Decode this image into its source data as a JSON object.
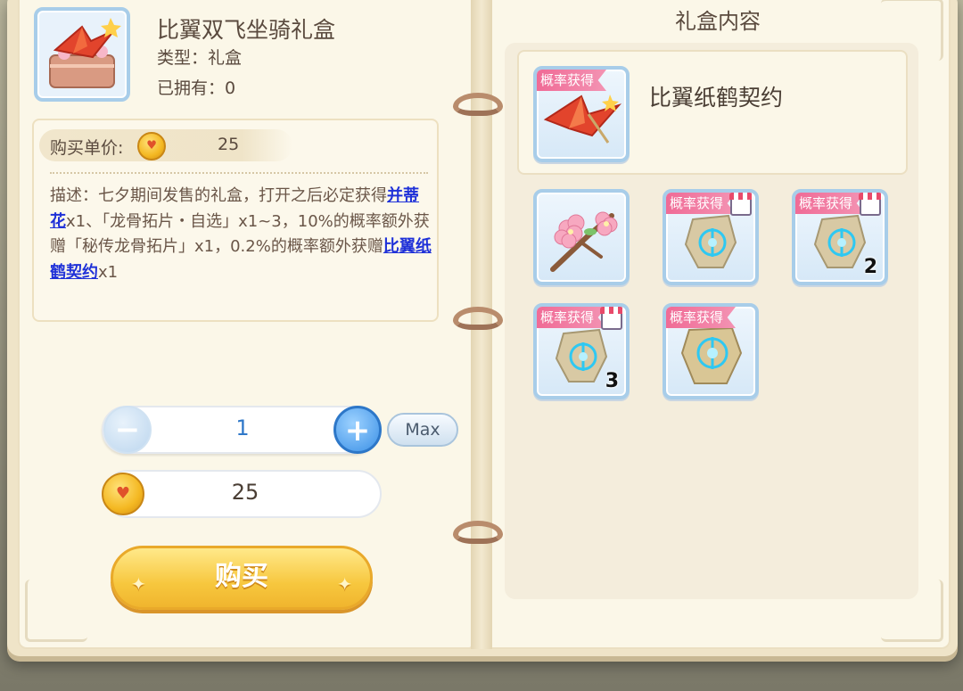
{
  "item": {
    "name": "比翼双飞坐骑礼盒",
    "type_label": "类型：礼盒",
    "owned_label": "已拥有：0",
    "icon": "gift-box-crane-icon"
  },
  "price": {
    "label": "购买单价:",
    "value": "25",
    "currency_icon": "gold-coin-icon"
  },
  "description": {
    "prefix": "描述：七夕期间发售的礼盒，打开之后必定获得",
    "link1": "并蒂花",
    "mid1": "x1、「龙骨拓片・自选」x1~3，10%的概率额外获赠「秘传龙骨拓片」x1，0.2%的概率额外获赠",
    "link2": "比翼纸鹤契约",
    "suffix": "x1"
  },
  "quantity": {
    "value": "1",
    "max_label": "Max"
  },
  "total": {
    "value": "25"
  },
  "buy_label": "购买",
  "contents": {
    "title": "礼盒内容",
    "featured": {
      "tag": "概率获得",
      "name": "比翼纸鹤契约",
      "icon": "paper-crane-icon"
    },
    "items": [
      {
        "name": "cherry-blossom-branch",
        "icon": "cherry-blossom-icon",
        "tag": "",
        "count": "",
        "shop": false
      },
      {
        "name": "dragon-bone-rubbing",
        "icon": "bone-rubbing-icon",
        "tag": "概率获得",
        "count": "",
        "shop": true
      },
      {
        "name": "dragon-bone-rubbing-2",
        "icon": "bone-rubbing-icon",
        "tag": "概率获得",
        "count": "2",
        "shop": true
      },
      {
        "name": "dragon-bone-rubbing-3",
        "icon": "bone-rubbing-icon",
        "tag": "概率获得",
        "count": "3",
        "shop": true
      },
      {
        "name": "secret-dragon-bone-rubbing",
        "icon": "bone-rubbing-icon",
        "tag": "概率获得",
        "count": "",
        "shop": false
      }
    ]
  }
}
